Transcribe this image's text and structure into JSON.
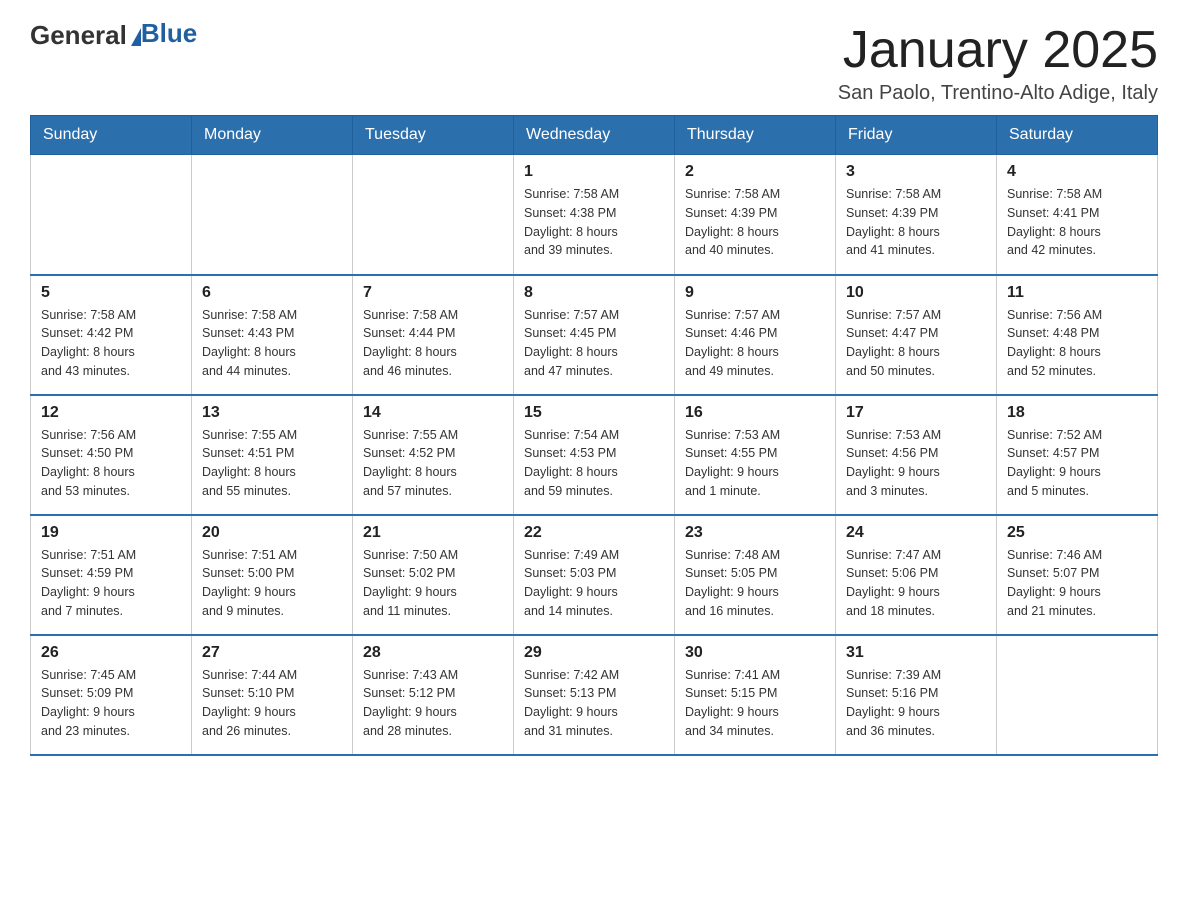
{
  "header": {
    "logo_general": "General",
    "logo_blue": "Blue",
    "month_title": "January 2025",
    "location": "San Paolo, Trentino-Alto Adige, Italy"
  },
  "days_of_week": [
    "Sunday",
    "Monday",
    "Tuesday",
    "Wednesday",
    "Thursday",
    "Friday",
    "Saturday"
  ],
  "weeks": [
    [
      {
        "day": "",
        "info": ""
      },
      {
        "day": "",
        "info": ""
      },
      {
        "day": "",
        "info": ""
      },
      {
        "day": "1",
        "info": "Sunrise: 7:58 AM\nSunset: 4:38 PM\nDaylight: 8 hours\nand 39 minutes."
      },
      {
        "day": "2",
        "info": "Sunrise: 7:58 AM\nSunset: 4:39 PM\nDaylight: 8 hours\nand 40 minutes."
      },
      {
        "day": "3",
        "info": "Sunrise: 7:58 AM\nSunset: 4:39 PM\nDaylight: 8 hours\nand 41 minutes."
      },
      {
        "day": "4",
        "info": "Sunrise: 7:58 AM\nSunset: 4:41 PM\nDaylight: 8 hours\nand 42 minutes."
      }
    ],
    [
      {
        "day": "5",
        "info": "Sunrise: 7:58 AM\nSunset: 4:42 PM\nDaylight: 8 hours\nand 43 minutes."
      },
      {
        "day": "6",
        "info": "Sunrise: 7:58 AM\nSunset: 4:43 PM\nDaylight: 8 hours\nand 44 minutes."
      },
      {
        "day": "7",
        "info": "Sunrise: 7:58 AM\nSunset: 4:44 PM\nDaylight: 8 hours\nand 46 minutes."
      },
      {
        "day": "8",
        "info": "Sunrise: 7:57 AM\nSunset: 4:45 PM\nDaylight: 8 hours\nand 47 minutes."
      },
      {
        "day": "9",
        "info": "Sunrise: 7:57 AM\nSunset: 4:46 PM\nDaylight: 8 hours\nand 49 minutes."
      },
      {
        "day": "10",
        "info": "Sunrise: 7:57 AM\nSunset: 4:47 PM\nDaylight: 8 hours\nand 50 minutes."
      },
      {
        "day": "11",
        "info": "Sunrise: 7:56 AM\nSunset: 4:48 PM\nDaylight: 8 hours\nand 52 minutes."
      }
    ],
    [
      {
        "day": "12",
        "info": "Sunrise: 7:56 AM\nSunset: 4:50 PM\nDaylight: 8 hours\nand 53 minutes."
      },
      {
        "day": "13",
        "info": "Sunrise: 7:55 AM\nSunset: 4:51 PM\nDaylight: 8 hours\nand 55 minutes."
      },
      {
        "day": "14",
        "info": "Sunrise: 7:55 AM\nSunset: 4:52 PM\nDaylight: 8 hours\nand 57 minutes."
      },
      {
        "day": "15",
        "info": "Sunrise: 7:54 AM\nSunset: 4:53 PM\nDaylight: 8 hours\nand 59 minutes."
      },
      {
        "day": "16",
        "info": "Sunrise: 7:53 AM\nSunset: 4:55 PM\nDaylight: 9 hours\nand 1 minute."
      },
      {
        "day": "17",
        "info": "Sunrise: 7:53 AM\nSunset: 4:56 PM\nDaylight: 9 hours\nand 3 minutes."
      },
      {
        "day": "18",
        "info": "Sunrise: 7:52 AM\nSunset: 4:57 PM\nDaylight: 9 hours\nand 5 minutes."
      }
    ],
    [
      {
        "day": "19",
        "info": "Sunrise: 7:51 AM\nSunset: 4:59 PM\nDaylight: 9 hours\nand 7 minutes."
      },
      {
        "day": "20",
        "info": "Sunrise: 7:51 AM\nSunset: 5:00 PM\nDaylight: 9 hours\nand 9 minutes."
      },
      {
        "day": "21",
        "info": "Sunrise: 7:50 AM\nSunset: 5:02 PM\nDaylight: 9 hours\nand 11 minutes."
      },
      {
        "day": "22",
        "info": "Sunrise: 7:49 AM\nSunset: 5:03 PM\nDaylight: 9 hours\nand 14 minutes."
      },
      {
        "day": "23",
        "info": "Sunrise: 7:48 AM\nSunset: 5:05 PM\nDaylight: 9 hours\nand 16 minutes."
      },
      {
        "day": "24",
        "info": "Sunrise: 7:47 AM\nSunset: 5:06 PM\nDaylight: 9 hours\nand 18 minutes."
      },
      {
        "day": "25",
        "info": "Sunrise: 7:46 AM\nSunset: 5:07 PM\nDaylight: 9 hours\nand 21 minutes."
      }
    ],
    [
      {
        "day": "26",
        "info": "Sunrise: 7:45 AM\nSunset: 5:09 PM\nDaylight: 9 hours\nand 23 minutes."
      },
      {
        "day": "27",
        "info": "Sunrise: 7:44 AM\nSunset: 5:10 PM\nDaylight: 9 hours\nand 26 minutes."
      },
      {
        "day": "28",
        "info": "Sunrise: 7:43 AM\nSunset: 5:12 PM\nDaylight: 9 hours\nand 28 minutes."
      },
      {
        "day": "29",
        "info": "Sunrise: 7:42 AM\nSunset: 5:13 PM\nDaylight: 9 hours\nand 31 minutes."
      },
      {
        "day": "30",
        "info": "Sunrise: 7:41 AM\nSunset: 5:15 PM\nDaylight: 9 hours\nand 34 minutes."
      },
      {
        "day": "31",
        "info": "Sunrise: 7:39 AM\nSunset: 5:16 PM\nDaylight: 9 hours\nand 36 minutes."
      },
      {
        "day": "",
        "info": ""
      }
    ]
  ]
}
